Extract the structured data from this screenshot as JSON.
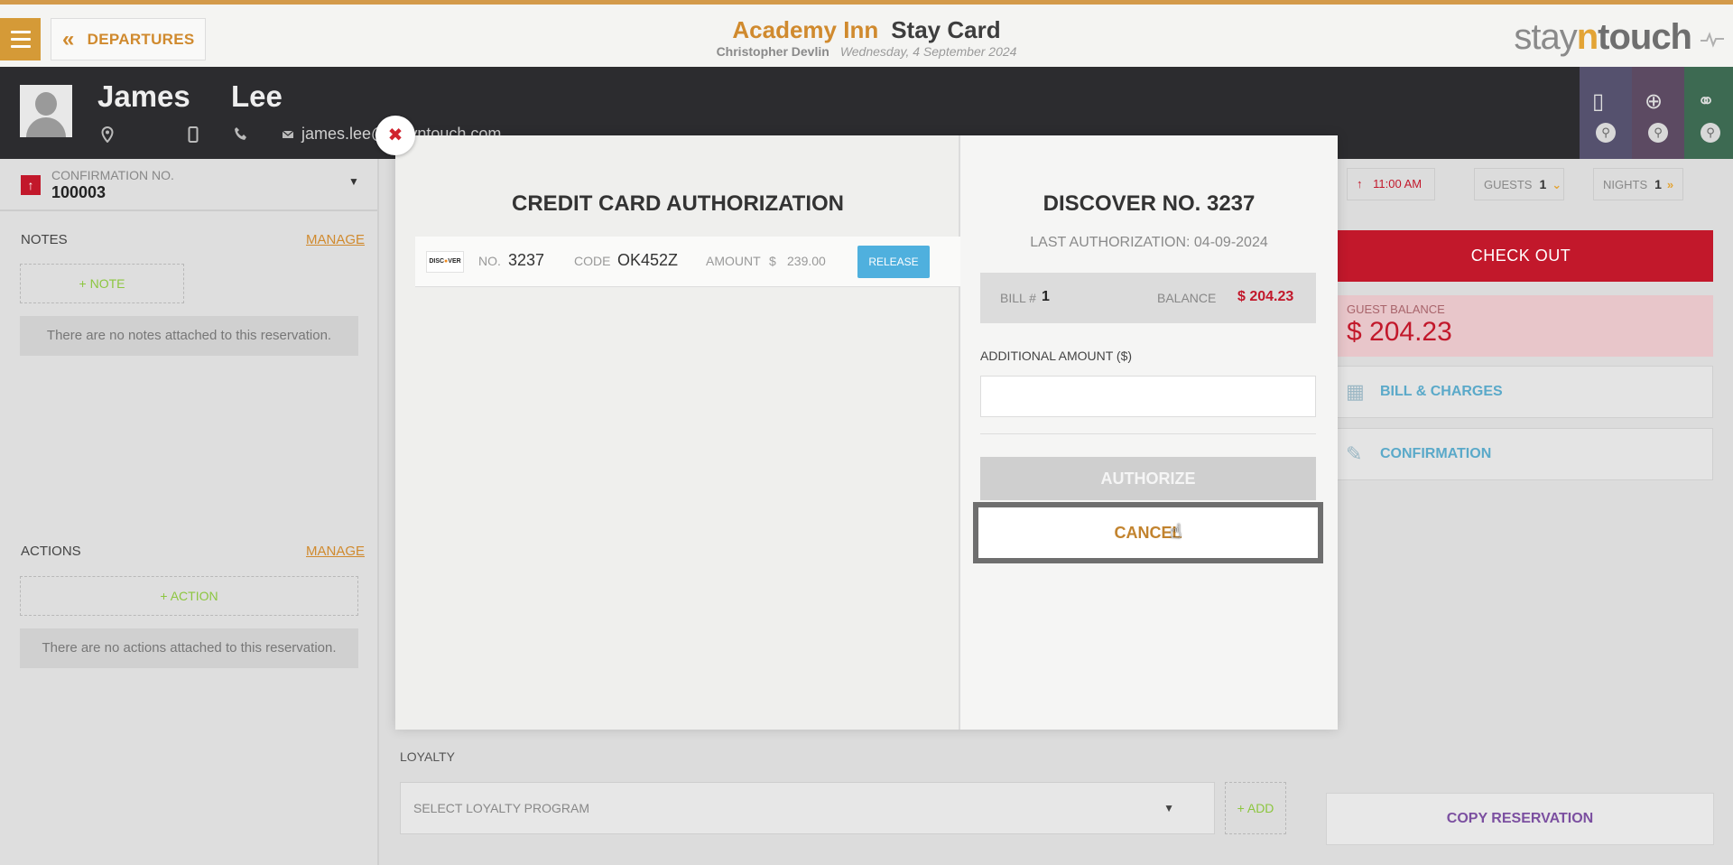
{
  "header": {
    "back_label": "DEPARTURES",
    "hotel_name": "Academy Inn",
    "page_title": "Stay Card",
    "user_name": "Christopher Devlin",
    "date": "Wednesday, 4 September 2024",
    "logo_stay": "stay",
    "logo_n": "n",
    "logo_touch": "touch"
  },
  "guest": {
    "first_name": "James",
    "last_name": "Lee",
    "email": "james.lee@stayntouch.com"
  },
  "sidebar": {
    "conf_label": "CONFIRMATION NO.",
    "conf_no": "100003",
    "notes_label": "NOTES",
    "notes_manage": "MANAGE",
    "add_note": "+ NOTE",
    "no_notes": "There are no notes attached to this reservation.",
    "actions_label": "ACTIONS",
    "actions_manage": "MANAGE",
    "add_action": "+ ACTION",
    "no_actions": "There are no actions attached to this reservation."
  },
  "status": {
    "time": "11:00 AM",
    "guests_label": "GUESTS",
    "guests_value": "1",
    "nights_label": "NIGHTS",
    "nights_value": "1"
  },
  "right_panel": {
    "checkout": "CHECK OUT",
    "balance_label": "GUEST BALANCE",
    "balance_value": "$ 204.23",
    "bill_charges": "BILL & CHARGES",
    "confirmation": "CONFIRMATION",
    "copy_reservation": "COPY RESERVATION"
  },
  "loyalty": {
    "label": "LOYALTY",
    "select_placeholder": "SELECT LOYALTY PROGRAM",
    "add": "+ ADD"
  },
  "modal": {
    "title": "CREDIT CARD AUTHORIZATION",
    "card": {
      "brand": "DISCOVER",
      "no_label": "NO.",
      "no": "3237",
      "code_label": "CODE",
      "code": "OK452Z",
      "amount_label": "AMOUNT",
      "currency": "$",
      "amount": "239.00",
      "release": "RELEASE"
    },
    "right_title": "DISCOVER NO. 3237",
    "last_auth": "LAST AUTHORIZATION: 04-09-2024",
    "bill_label": "BILL #",
    "bill_no": "1",
    "balance_label": "BALANCE",
    "balance": "$ 204.23",
    "additional_label": "ADDITIONAL AMOUNT ($)",
    "additional_value": "",
    "authorize": "AUTHORIZE",
    "cancel": "CANCEL"
  },
  "colors": {
    "accent": "#d08a2e",
    "danger": "#c2182b",
    "info": "#4fb0de",
    "purple": "#7b4fa0"
  },
  "icons": [
    "menu-icon",
    "chevron-left-icon",
    "pulse-icon",
    "location-icon",
    "mobile-icon",
    "phone-icon",
    "mail-icon",
    "close-icon",
    "arrow-up-icon",
    "calculator-icon",
    "pencil-icon",
    "cursor-icon"
  ]
}
